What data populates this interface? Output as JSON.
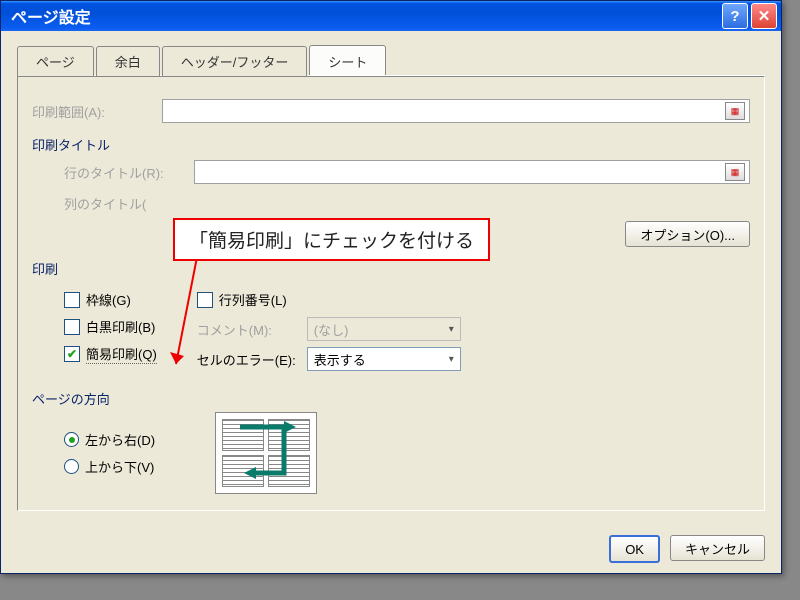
{
  "title": "ページ設定",
  "tabs": [
    "ページ",
    "余白",
    "ヘッダー/フッター",
    "シート"
  ],
  "active_tab": "シート",
  "print_range_label": "印刷範囲(A):",
  "section_titles": {
    "print_titles": "印刷タイトル",
    "print": "印刷",
    "page_order": "ページの方向"
  },
  "row_title_label": "行のタイトル(R):",
  "col_title_label": "列のタイトル(",
  "checkboxes": {
    "gridlines": "枠線(G)",
    "bw": "白黒印刷(B)",
    "draft": "簡易印刷(Q)",
    "rowcol": "行列番号(L)"
  },
  "comment_label": "コメント(M):",
  "comment_value": "(なし)",
  "error_label": "セルのエラー(E):",
  "error_value": "表示する",
  "order": {
    "ltr": "左から右(D)",
    "ttb": "上から下(V)"
  },
  "options_btn": "オプション(O)...",
  "ok": "OK",
  "cancel": "キャンセル",
  "checked": {
    "draft": true,
    "ltr": true
  },
  "callout": "「簡易印刷」にチェックを付ける"
}
